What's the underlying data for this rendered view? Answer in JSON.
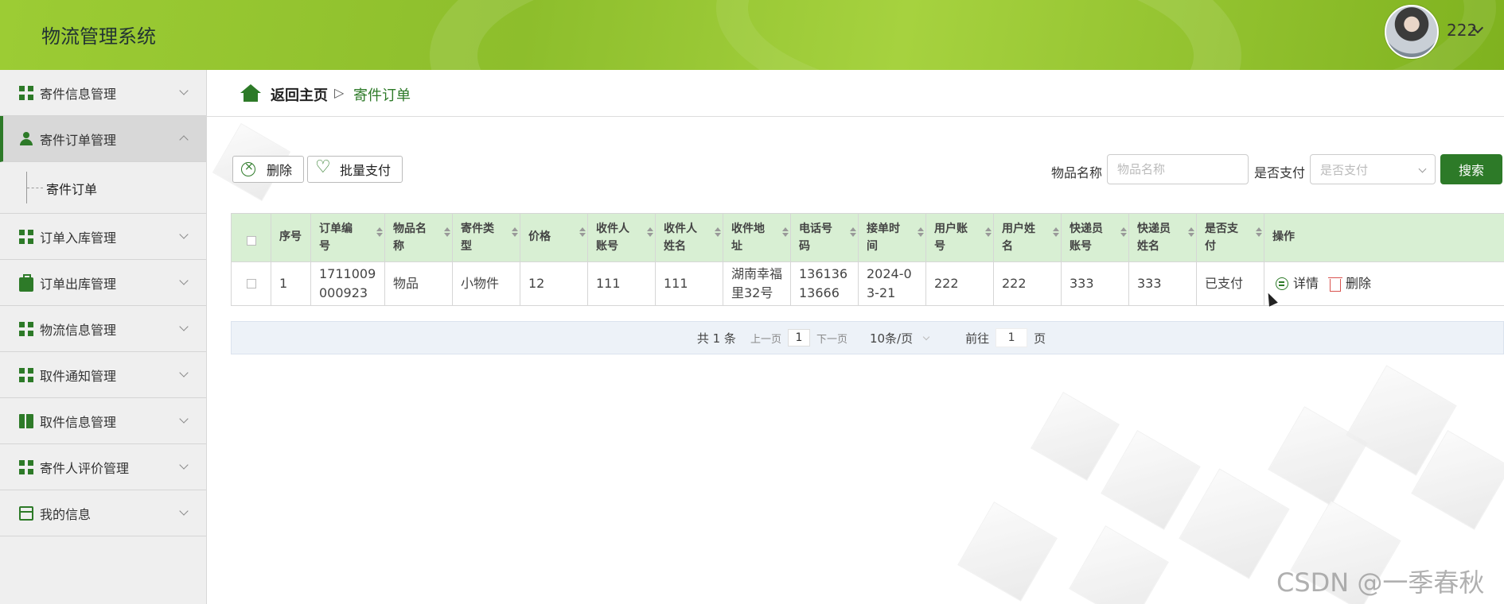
{
  "app": {
    "title": "物流管理系统",
    "user_name": "222"
  },
  "sidebar": {
    "items": [
      {
        "label": "寄件信息管理",
        "icon": "grid-icon"
      },
      {
        "label": "寄件订单管理",
        "icon": "person-icon",
        "expanded": true
      },
      {
        "label": "订单入库管理",
        "icon": "grid-icon"
      },
      {
        "label": "订单出库管理",
        "icon": "briefcase-icon"
      },
      {
        "label": "物流信息管理",
        "icon": "grid-icon"
      },
      {
        "label": "取件通知管理",
        "icon": "grid-icon"
      },
      {
        "label": "取件信息管理",
        "icon": "book-icon"
      },
      {
        "label": "寄件人评价管理",
        "icon": "grid-icon"
      },
      {
        "label": "我的信息",
        "icon": "card-icon"
      }
    ],
    "submenu": {
      "label": "寄件订单"
    }
  },
  "breadcrumb": {
    "home": "返回主页",
    "separator": "▷",
    "current": "寄件订单"
  },
  "toolbar": {
    "delete_label": "删除",
    "batch_pay_label": "批量支付",
    "search_name_label": "物品名称",
    "search_name_placeholder": "物品名称",
    "search_paid_label": "是否支付",
    "search_paid_placeholder": "是否支付",
    "search_button": "搜索"
  },
  "table": {
    "columns": [
      "序号",
      "订单编号",
      "物品名称",
      "寄件类型",
      "价格",
      "收件人账号",
      "收件人姓名",
      "收件地址",
      "电话号码",
      "接单时间",
      "用户账号",
      "用户姓名",
      "快递员账号",
      "快递员姓名",
      "是否支付",
      "操作"
    ],
    "rows": [
      {
        "index": "1",
        "order_no": "1711009000923",
        "item_name": "物品",
        "type": "小物件",
        "price": "12",
        "recipient_account": "111",
        "recipient_name": "111",
        "address": "湖南幸福里32号",
        "phone": "13613613666",
        "time": "2024-03-21",
        "user_account": "222",
        "user_name": "222",
        "courier_account": "333",
        "courier_name": "333",
        "paid": "已支付",
        "detail_label": "详情",
        "delete_label": "删除"
      }
    ]
  },
  "pagination": {
    "total": "共 1 条",
    "prev": "上一页",
    "current_page": "1",
    "next": "下一页",
    "page_size": "10条/页",
    "goto_label": "前往",
    "goto_value": "1",
    "page_suffix": "页"
  },
  "watermark": "CSDN @一季春秋",
  "colors": {
    "brand": "#2d7a28",
    "header": "#9ccc34",
    "table_header": "#d8efd3"
  }
}
